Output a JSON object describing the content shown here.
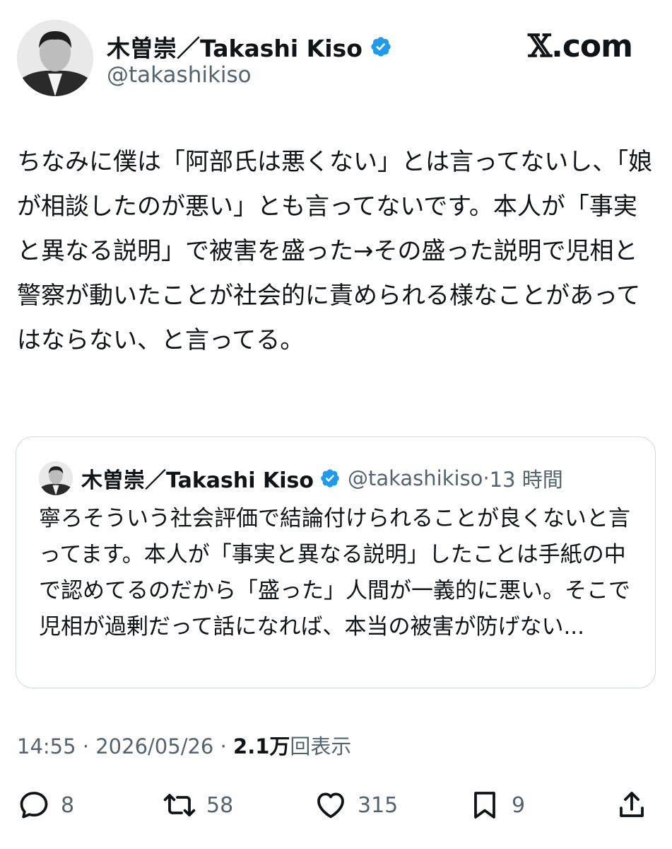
{
  "author": {
    "name": "木曽崇／Takashi Kiso",
    "handle": "@takashikiso"
  },
  "brand": {
    "x_mark": "𝕏",
    "suffix": ".com"
  },
  "tweet": {
    "text": "ちなみに僕は「阿部氏は悪くない」とは言ってないし、「娘が相談したのが悪い」とも言ってないです。本人が「事実と異なる説明」で被害を盛った→その盛った説明で児相と警察が動いたことが社会的に責められる様なことがあってはならない、と言ってる。"
  },
  "quote": {
    "name": "木曽崇／Takashi Kiso",
    "handle": "@takashikiso",
    "separator": " · ",
    "time": "13 時間",
    "text": "寧ろそういう社会評価で結論付けられることが良くないと言ってます。本人が「事実と異なる説明」したことは手紙の中で認めてるのだから「盛った」人間が一義的に悪い。そこで児相が過剰だって話になれば、本当の被害が防げない..."
  },
  "meta": {
    "time": "14:55",
    "sep1": " · ",
    "date": "2026/05/26",
    "sep2": " · ",
    "views_count": "2.1万",
    "views_label": "回表示"
  },
  "actions": {
    "reply_count": "8",
    "retweet_count": "58",
    "like_count": "315",
    "bookmark_count": "9"
  },
  "colors": {
    "verified": "#1d9bf0",
    "secondary_text": "#536471",
    "primary_text": "#0f1419",
    "border": "#cfd9de"
  },
  "icons": [
    "verified-badge-icon",
    "reply-icon",
    "retweet-icon",
    "like-icon",
    "bookmark-icon",
    "share-icon"
  ]
}
